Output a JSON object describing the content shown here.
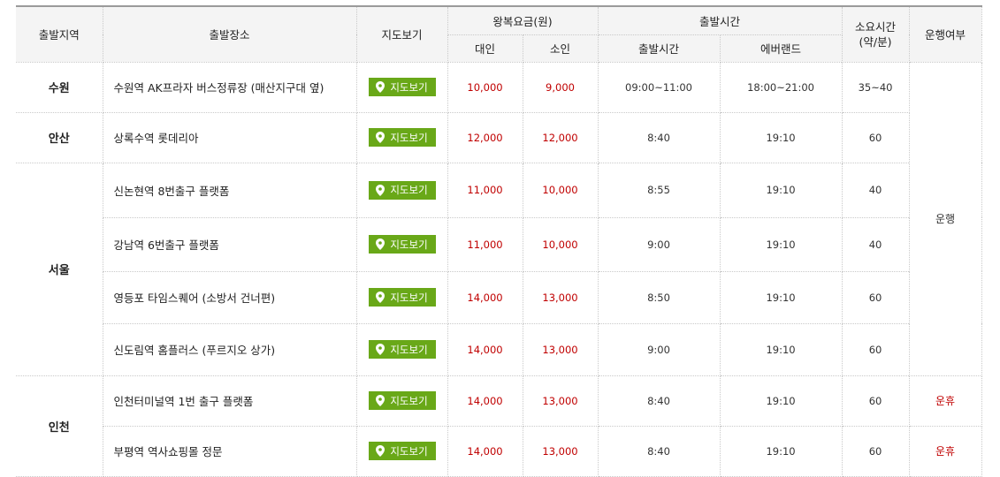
{
  "header": {
    "region": "출발지역",
    "place": "출발장소",
    "map": "지도보기",
    "fare": "왕복요금(원)",
    "adult": "대인",
    "child": "소인",
    "departure": "출발시간",
    "dep_time": "출발시간",
    "everland": "에버랜드",
    "duration": "소요시간\n(약/분)",
    "operation": "운행여부"
  },
  "map_button_label": "지도보기",
  "regions": [
    "수원",
    "안산",
    "서울",
    "인천"
  ],
  "rows": [
    {
      "place": "수원역 AK프라자 버스정류장 (매산지구대 옆)",
      "adult": "10,000",
      "child": "9,000",
      "dep": "09:00~11:00",
      "everland": "18:00~21:00",
      "duration": "35~40"
    },
    {
      "place": "상록수역 롯데리아",
      "adult": "12,000",
      "child": "12,000",
      "dep": "8:40",
      "everland": "19:10",
      "duration": "60"
    },
    {
      "place": "신논현역 8번출구 플랫폼",
      "adult": "11,000",
      "child": "10,000",
      "dep": "8:55",
      "everland": "19:10",
      "duration": "40"
    },
    {
      "place": "강남역 6번출구 플랫폼",
      "adult": "11,000",
      "child": "10,000",
      "dep": "9:00",
      "everland": "19:10",
      "duration": "40"
    },
    {
      "place": "영등포 타임스퀘어 (소방서 건너편)",
      "adult": "14,000",
      "child": "13,000",
      "dep": "8:50",
      "everland": "19:10",
      "duration": "60"
    },
    {
      "place": "신도림역 홈플러스 (푸르지오 상가)",
      "adult": "14,000",
      "child": "13,000",
      "dep": "9:00",
      "everland": "19:10",
      "duration": "60"
    },
    {
      "place": "인천터미널역 1번 출구 플랫폼",
      "adult": "14,000",
      "child": "13,000",
      "dep": "8:40",
      "everland": "19:10",
      "duration": "60"
    },
    {
      "place": "부평역 역사쇼핑몰 정문",
      "adult": "14,000",
      "child": "13,000",
      "dep": "8:40",
      "everland": "19:10",
      "duration": "60"
    }
  ],
  "status": {
    "operating": "운행",
    "suspended": "운휴"
  },
  "colors": {
    "fare_text": "#c00000",
    "map_button": "#69a818",
    "header_bg": "#f4f4f4"
  }
}
